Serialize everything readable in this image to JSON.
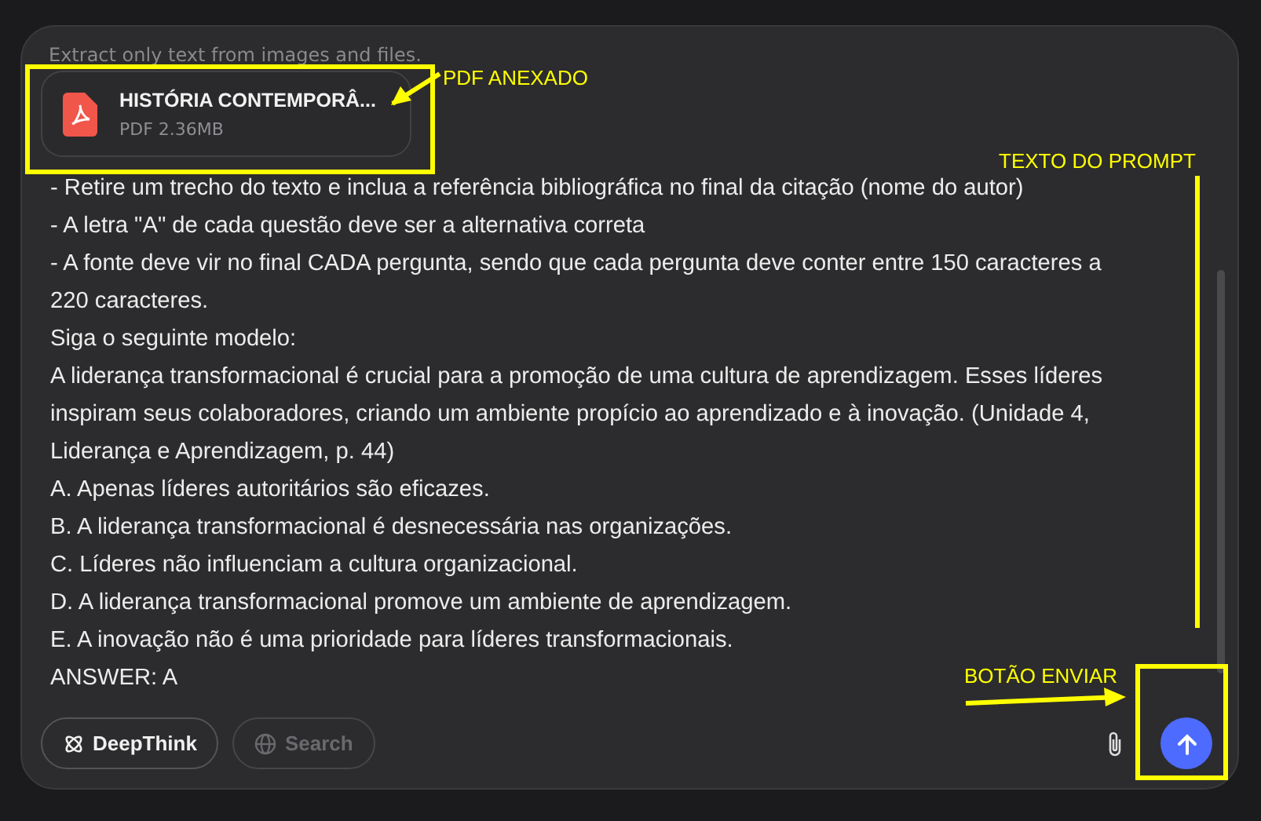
{
  "composer": {
    "hint": "Extract only text from images and files.",
    "attachment": {
      "name": "HISTÓRIA CONTEMPORÂ...",
      "meta": "PDF 2.36MB"
    },
    "prompt_lines": [
      "- Retire um trecho do texto e inclua a referência bibliográfica no final da citação (nome do autor)",
      "- A letra \"A\" de cada questão deve ser a alternativa correta",
      "- A fonte deve vir no final CADA pergunta, sendo que cada pergunta deve conter entre 150 caracteres a",
      "220 caracteres.",
      "Siga o seguinte modelo:",
      "A liderança transformacional é crucial para a promoção de uma cultura de aprendizagem. Esses líderes",
      "inspiram seus colaboradores, criando um ambiente propício ao aprendizado e à inovação. (Unidade 4,",
      "Liderança e Aprendizagem, p. 44)",
      "A. Apenas líderes autoritários são eficazes.",
      "B. A liderança transformacional é desnecessária nas organizações.",
      "C. Líderes não influenciam a cultura organizacional.",
      "D. A liderança transformacional promove um ambiente de aprendizagem.",
      "E. A inovação não é uma prioridade para líderes transformacionais.",
      "ANSWER: A"
    ],
    "toggles": [
      {
        "label": "DeepThink",
        "kind": "deepthink",
        "on": true
      },
      {
        "label": "Search",
        "kind": "search",
        "on": false
      }
    ]
  },
  "annotations": [
    {
      "kind": "box"
    },
    {
      "kind": "arrow"
    },
    {
      "kind": "label",
      "text": "PDF ANEXADO"
    },
    {
      "kind": "label",
      "text": "TEXTO DO PROMPT"
    },
    {
      "kind": "line"
    },
    {
      "kind": "label",
      "text": "BOTÃO ENVIAR"
    },
    {
      "kind": "arrow"
    },
    {
      "kind": "box"
    }
  ]
}
